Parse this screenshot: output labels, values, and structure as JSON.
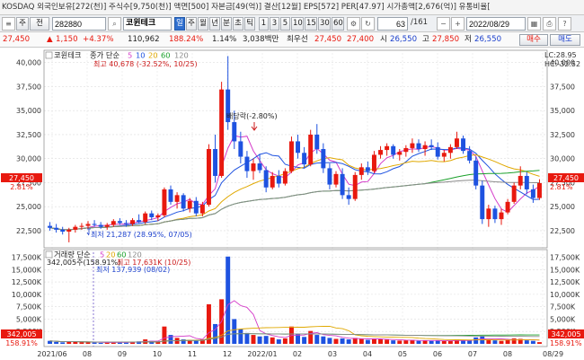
{
  "infobar": {
    "text": "KOSDAQ 외국인보유[272(천)] 주식수[9,750(천)] 액면[500] 자본금[49(억)] 결산[12월] EPS[572] PER[47.97] 시가총액[2,676(억)] 유통비율[",
    "short": "KOSDAQ"
  },
  "toolbar": {
    "stock_code": "282880",
    "stock_name": "코윈테크",
    "period_buttons": [
      "일",
      "주",
      "월",
      "년",
      "분",
      "초",
      "틱"
    ],
    "active_period": "일",
    "interval_buttons": [
      "1",
      "3",
      "5",
      "10",
      "15",
      "30",
      "60"
    ],
    "count_value": "63",
    "count_total": "/161",
    "date_value": "2022/08/29",
    "icon_labels": [
      "주",
      "전"
    ]
  },
  "pricebar": {
    "price": "27,450",
    "change_sign": "▲",
    "change": "1,150",
    "change_pct": "+4.37%",
    "volume": "110,962",
    "vol_pct": "188.24%",
    "turnover": "1.14%",
    "amount": "3,038백만",
    "bid_label": "최우선",
    "bid": "27,450",
    "ask": "27,400",
    "open_label": "시",
    "open": "26,550",
    "high_label": "고",
    "high": "27,850",
    "low_label": "저",
    "low": "26,550",
    "buy_label": "매수",
    "sell_label": "매도"
  },
  "price_panel": {
    "stock_label": "코윈테크",
    "ma_label": "종가 단순",
    "ma_periods": [
      "5",
      "10",
      "20",
      "60",
      "120"
    ],
    "max_annotation": "최고 40,678 (-32.52%, 10/25)",
    "min_annotation": "최저 21,287 (28.95%, 07/05)",
    "dividend_annotation": "배당락(-2.80%)",
    "current_price_tag": "27,450",
    "current_pct_tag": "2.81%",
    "lc_label": "LC:28.95",
    "hc_label": "HC:-32.52"
  },
  "volume_panel": {
    "label": "거래량 단순",
    "ma_periods": [
      "5",
      "20",
      "60",
      "120"
    ],
    "cursor_annotation": "342,005주(158.91%)",
    "max_annotation": "최고 17,631K (10/25)",
    "min_annotation": "최저 137,939 (08/02)",
    "current_volume_tag": "342,005",
    "current_pct_tag": "158.91%"
  },
  "colors": {
    "up": "#e8190f",
    "down": "#1e52e0",
    "ma5": "#d43bc9",
    "ma10": "#1e52e0",
    "ma20": "#e0a800",
    "ma60": "#1aa02a",
    "ma120": "#8a8a8a",
    "tag_bg": "#e8190f"
  },
  "chart_data": {
    "type": "candlestick",
    "price_axis": {
      "ticks": [
        22500,
        25000,
        27500,
        30000,
        32500,
        35000,
        37500,
        40000
      ],
      "range": [
        21000,
        41000
      ]
    },
    "volume_axis": {
      "ticks": [
        "2,500K",
        "5,000K",
        "7,500K",
        "10,000K",
        "12,500K",
        "15,000K",
        "17,500K"
      ],
      "values": [
        2500,
        5000,
        7500,
        10000,
        12500,
        15000,
        17500
      ],
      "range": [
        0,
        18500
      ]
    },
    "x_labels": [
      "2021/06",
      "08",
      "09",
      "10",
      "11",
      "12",
      "2022/01",
      "02",
      "03",
      "04",
      "05",
      "06",
      "07",
      "08",
      "08/29"
    ],
    "candles": [
      {
        "o": 23000,
        "h": 23400,
        "l": 22500,
        "c": 22800,
        "v": 600
      },
      {
        "o": 22800,
        "h": 23200,
        "l": 22300,
        "c": 22600,
        "v": 400
      },
      {
        "o": 22600,
        "h": 22900,
        "l": 22100,
        "c": 22400,
        "v": 300
      },
      {
        "o": 22400,
        "h": 22800,
        "l": 21287,
        "c": 22600,
        "v": 500
      },
      {
        "o": 22600,
        "h": 23100,
        "l": 22300,
        "c": 22900,
        "v": 400
      },
      {
        "o": 22900,
        "h": 23300,
        "l": 22600,
        "c": 23000,
        "v": 350
      },
      {
        "o": 23000,
        "h": 23500,
        "l": 22700,
        "c": 23200,
        "v": 300
      },
      {
        "o": 23200,
        "h": 23600,
        "l": 22900,
        "c": 23100,
        "v": 250
      },
      {
        "o": 23100,
        "h": 23400,
        "l": 22700,
        "c": 22900,
        "v": 200
      },
      {
        "o": 22900,
        "h": 23300,
        "l": 22600,
        "c": 23100,
        "v": 300
      },
      {
        "o": 23100,
        "h": 23700,
        "l": 22900,
        "c": 23500,
        "v": 400
      },
      {
        "o": 23500,
        "h": 23800,
        "l": 23100,
        "c": 23300,
        "v": 300
      },
      {
        "o": 23300,
        "h": 23600,
        "l": 22900,
        "c": 23200,
        "v": 250
      },
      {
        "o": 23200,
        "h": 23800,
        "l": 23000,
        "c": 23600,
        "v": 350
      },
      {
        "o": 23600,
        "h": 24200,
        "l": 23300,
        "c": 23400,
        "v": 500
      },
      {
        "o": 23400,
        "h": 24500,
        "l": 23200,
        "c": 24300,
        "v": 900
      },
      {
        "o": 24300,
        "h": 24600,
        "l": 23600,
        "c": 23900,
        "v": 600
      },
      {
        "o": 23900,
        "h": 24300,
        "l": 23500,
        "c": 24100,
        "v": 400
      },
      {
        "o": 24100,
        "h": 27000,
        "l": 23900,
        "c": 26800,
        "v": 3500
      },
      {
        "o": 26800,
        "h": 27200,
        "l": 25200,
        "c": 25500,
        "v": 1800
      },
      {
        "o": 25500,
        "h": 26500,
        "l": 24800,
        "c": 26200,
        "v": 1200
      },
      {
        "o": 26200,
        "h": 26400,
        "l": 24500,
        "c": 24800,
        "v": 900
      },
      {
        "o": 24800,
        "h": 25900,
        "l": 24400,
        "c": 25600,
        "v": 800
      },
      {
        "o": 25600,
        "h": 26000,
        "l": 24000,
        "c": 24300,
        "v": 700
      },
      {
        "o": 24300,
        "h": 25500,
        "l": 24000,
        "c": 25200,
        "v": 900
      },
      {
        "o": 25200,
        "h": 31500,
        "l": 25000,
        "c": 31000,
        "v": 8000
      },
      {
        "o": 31000,
        "h": 32500,
        "l": 27500,
        "c": 28200,
        "v": 4000
      },
      {
        "o": 28200,
        "h": 38000,
        "l": 28000,
        "c": 37200,
        "v": 9000
      },
      {
        "o": 37200,
        "h": 40678,
        "l": 33000,
        "c": 33800,
        "v": 17631
      },
      {
        "o": 33800,
        "h": 35000,
        "l": 31000,
        "c": 31800,
        "v": 5000
      },
      {
        "o": 31800,
        "h": 32800,
        "l": 29500,
        "c": 30200,
        "v": 3000
      },
      {
        "o": 30200,
        "h": 30800,
        "l": 28000,
        "c": 28700,
        "v": 2200
      },
      {
        "o": 28700,
        "h": 30000,
        "l": 27800,
        "c": 29500,
        "v": 1800
      },
      {
        "o": 29500,
        "h": 30500,
        "l": 28500,
        "c": 28800,
        "v": 1500
      },
      {
        "o": 28800,
        "h": 29200,
        "l": 26500,
        "c": 27000,
        "v": 1600
      },
      {
        "o": 27000,
        "h": 28600,
        "l": 26800,
        "c": 28200,
        "v": 1300
      },
      {
        "o": 28200,
        "h": 28800,
        "l": 27000,
        "c": 27400,
        "v": 900
      },
      {
        "o": 27400,
        "h": 29000,
        "l": 27200,
        "c": 28700,
        "v": 1100
      },
      {
        "o": 28700,
        "h": 32300,
        "l": 28500,
        "c": 31800,
        "v": 3500
      },
      {
        "o": 31800,
        "h": 32500,
        "l": 30000,
        "c": 30600,
        "v": 2000
      },
      {
        "o": 30600,
        "h": 31200,
        "l": 29000,
        "c": 29400,
        "v": 1400
      },
      {
        "o": 29400,
        "h": 33000,
        "l": 29200,
        "c": 32500,
        "v": 2600
      },
      {
        "o": 32500,
        "h": 33600,
        "l": 30500,
        "c": 31000,
        "v": 1800
      },
      {
        "o": 31000,
        "h": 31600,
        "l": 28500,
        "c": 29000,
        "v": 1500
      },
      {
        "o": 29000,
        "h": 29500,
        "l": 26800,
        "c": 27300,
        "v": 1200
      },
      {
        "o": 27300,
        "h": 28700,
        "l": 27000,
        "c": 28400,
        "v": 1000
      },
      {
        "o": 28400,
        "h": 29000,
        "l": 25800,
        "c": 26200,
        "v": 1100
      },
      {
        "o": 26200,
        "h": 27000,
        "l": 25200,
        "c": 25800,
        "v": 900
      },
      {
        "o": 25800,
        "h": 28600,
        "l": 25600,
        "c": 28300,
        "v": 1200
      },
      {
        "o": 28300,
        "h": 29500,
        "l": 27800,
        "c": 29100,
        "v": 1000
      },
      {
        "o": 29100,
        "h": 29700,
        "l": 28300,
        "c": 28700,
        "v": 800
      },
      {
        "o": 28700,
        "h": 30800,
        "l": 28500,
        "c": 30400,
        "v": 1100
      },
      {
        "o": 30400,
        "h": 31300,
        "l": 30000,
        "c": 30900,
        "v": 900
      },
      {
        "o": 30900,
        "h": 31600,
        "l": 30300,
        "c": 31300,
        "v": 850
      },
      {
        "o": 31300,
        "h": 31500,
        "l": 30000,
        "c": 30400,
        "v": 700
      },
      {
        "o": 30400,
        "h": 31000,
        "l": 29800,
        "c": 30700,
        "v": 650
      },
      {
        "o": 30700,
        "h": 31400,
        "l": 30200,
        "c": 31100,
        "v": 700
      },
      {
        "o": 31100,
        "h": 32100,
        "l": 30600,
        "c": 31600,
        "v": 800
      },
      {
        "o": 31600,
        "h": 32000,
        "l": 30700,
        "c": 31000,
        "v": 600
      },
      {
        "o": 31000,
        "h": 31800,
        "l": 30300,
        "c": 31400,
        "v": 650
      },
      {
        "o": 31400,
        "h": 32000,
        "l": 30900,
        "c": 31200,
        "v": 600
      },
      {
        "o": 31200,
        "h": 31700,
        "l": 29900,
        "c": 30200,
        "v": 700
      },
      {
        "o": 30200,
        "h": 30900,
        "l": 29700,
        "c": 30600,
        "v": 550
      },
      {
        "o": 30600,
        "h": 31500,
        "l": 30000,
        "c": 31200,
        "v": 600
      },
      {
        "o": 31200,
        "h": 32800,
        "l": 31000,
        "c": 32100,
        "v": 900
      },
      {
        "o": 32100,
        "h": 32400,
        "l": 30500,
        "c": 30800,
        "v": 700
      },
      {
        "o": 30800,
        "h": 31300,
        "l": 29500,
        "c": 29800,
        "v": 650
      },
      {
        "o": 29800,
        "h": 30200,
        "l": 26800,
        "c": 27200,
        "v": 1300
      },
      {
        "o": 27200,
        "h": 27700,
        "l": 23200,
        "c": 23700,
        "v": 1500
      },
      {
        "o": 23700,
        "h": 25200,
        "l": 22900,
        "c": 24800,
        "v": 900
      },
      {
        "o": 24800,
        "h": 25100,
        "l": 23300,
        "c": 23700,
        "v": 700
      },
      {
        "o": 23700,
        "h": 24800,
        "l": 23100,
        "c": 24400,
        "v": 600
      },
      {
        "o": 24400,
        "h": 25800,
        "l": 24200,
        "c": 25500,
        "v": 800
      },
      {
        "o": 25500,
        "h": 27500,
        "l": 25300,
        "c": 27200,
        "v": 1100
      },
      {
        "o": 27200,
        "h": 29200,
        "l": 26800,
        "c": 28200,
        "v": 1000
      },
      {
        "o": 28200,
        "h": 28600,
        "l": 26300,
        "c": 26800,
        "v": 700
      },
      {
        "o": 26800,
        "h": 27300,
        "l": 25400,
        "c": 25900,
        "v": 600
      },
      {
        "o": 25900,
        "h": 27850,
        "l": 25700,
        "c": 27450,
        "v": 342
      }
    ]
  }
}
